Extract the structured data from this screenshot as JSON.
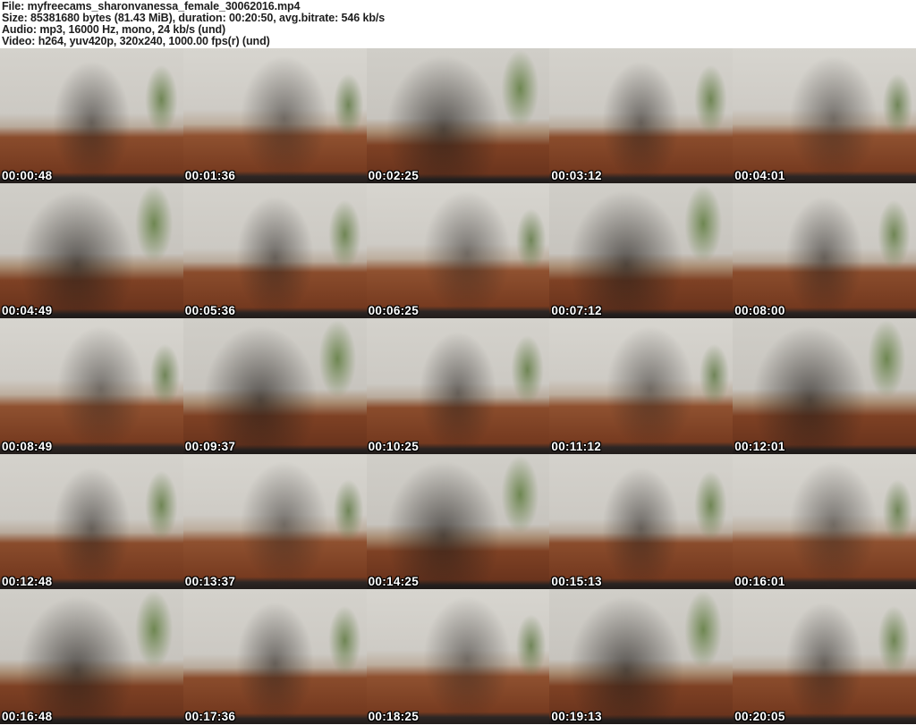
{
  "header": {
    "file_line": "File: myfreecams_sharonvanessa_female_30062016.mp4",
    "size_line": "Size: 85381680 bytes (81.43 MiB), duration: 00:20:50, avg.bitrate: 546 kb/s",
    "audio_line": "Audio: mp3, 16000 Hz, mono, 24 kb/s (und)",
    "video_line": "Video: h264, yuv420p, 320x240, 1000.00 fps(r) (und)"
  },
  "grid": {
    "columns": 5,
    "rows": 5,
    "thumbnail_width": 205,
    "thumbnail_height": 151
  },
  "thumbnails": [
    {
      "time": "00:00:48"
    },
    {
      "time": "00:01:36"
    },
    {
      "time": "00:02:25"
    },
    {
      "time": "00:03:12"
    },
    {
      "time": "00:04:01"
    },
    {
      "time": "00:04:49"
    },
    {
      "time": "00:05:36"
    },
    {
      "time": "00:06:25"
    },
    {
      "time": "00:07:12"
    },
    {
      "time": "00:08:00"
    },
    {
      "time": "00:08:49"
    },
    {
      "time": "00:09:37"
    },
    {
      "time": "00:10:25"
    },
    {
      "time": "00:11:12"
    },
    {
      "time": "00:12:01"
    },
    {
      "time": "00:12:48"
    },
    {
      "time": "00:13:37"
    },
    {
      "time": "00:14:25"
    },
    {
      "time": "00:15:13"
    },
    {
      "time": "00:16:01"
    },
    {
      "time": "00:16:48"
    },
    {
      "time": "00:17:36"
    },
    {
      "time": "00:18:25"
    },
    {
      "time": "00:19:13"
    },
    {
      "time": "00:20:05"
    }
  ],
  "colors": {
    "header_text": "#1d1d1d",
    "header_background": "#ffffff",
    "timestamp_text": "#ffffff",
    "timestamp_outline": "#000000",
    "wall": "#d0cec8",
    "floor": "#7e4124",
    "plant": "#65804 6"
  }
}
